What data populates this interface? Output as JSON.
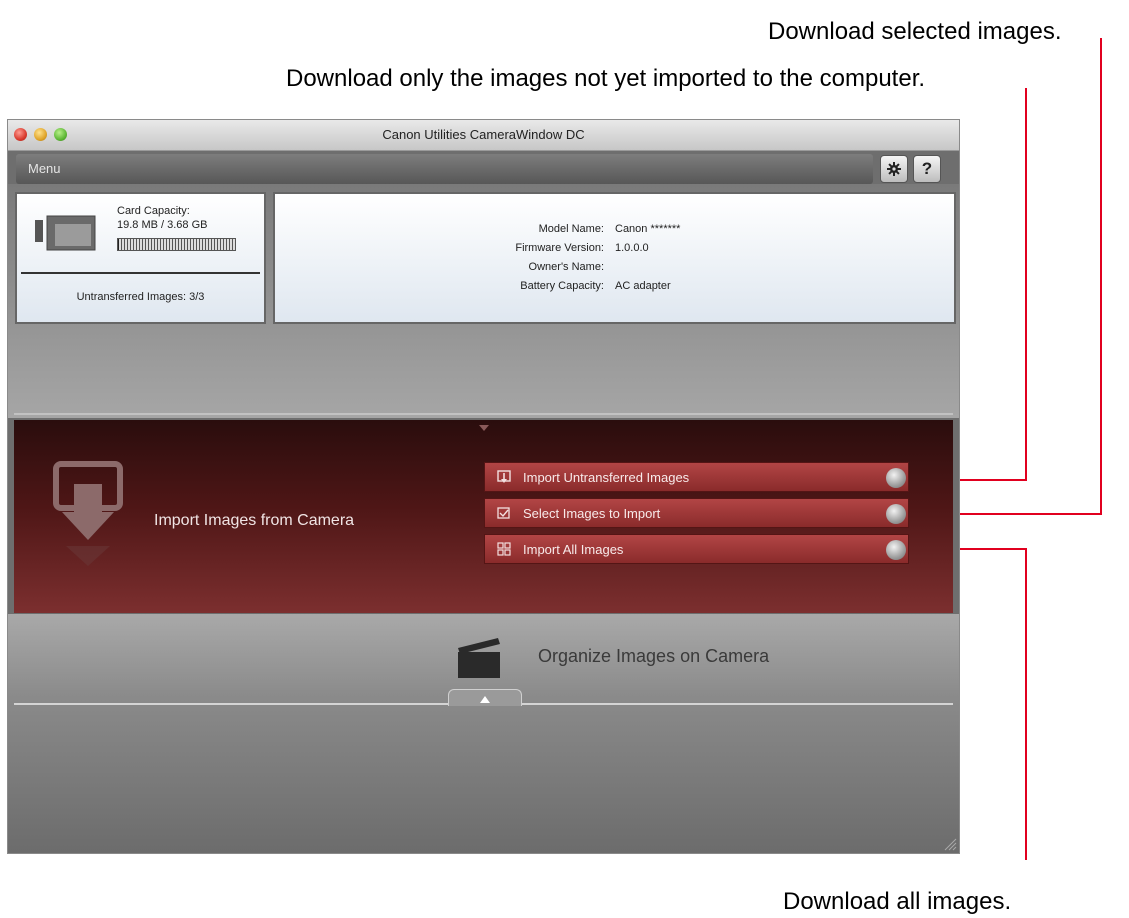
{
  "callouts": {
    "selected": "Download selected images.",
    "untransferred": "Download only the images not yet imported to the computer.",
    "all": "Download all images."
  },
  "window": {
    "title": "Canon Utilities CameraWindow DC",
    "menu_label": "Menu",
    "settings_icon": "gear-icon",
    "help_label": "?"
  },
  "card": {
    "capacity_label": "Card Capacity:",
    "capacity_value": "19.8 MB / 3.68 GB",
    "capacity_fill_fraction": 0.005,
    "untransferred": "Untransferred Images:  3/3"
  },
  "camera_info": {
    "model_label": "Model Name:",
    "model_value": "Canon *******",
    "firmware_label": "Firmware Version:",
    "firmware_value": "1.0.0.0",
    "owner_label": "Owner's Name:",
    "owner_value": "",
    "battery_label": "Battery Capacity:",
    "battery_value": "AC adapter"
  },
  "import": {
    "title": "Import Images from Camera",
    "buttons": [
      {
        "label": "Import Untransferred Images",
        "icon": "import-tray-icon"
      },
      {
        "label": "Select Images to Import",
        "icon": "checkbox-icon"
      },
      {
        "label": "Import All Images",
        "icon": "grid-icon"
      }
    ]
  },
  "organize": {
    "title": "Organize Images on Camera"
  },
  "colors": {
    "callout_line": "#e1001f",
    "import_panel": "#5a1c1c",
    "import_button": "#a33c3c"
  }
}
